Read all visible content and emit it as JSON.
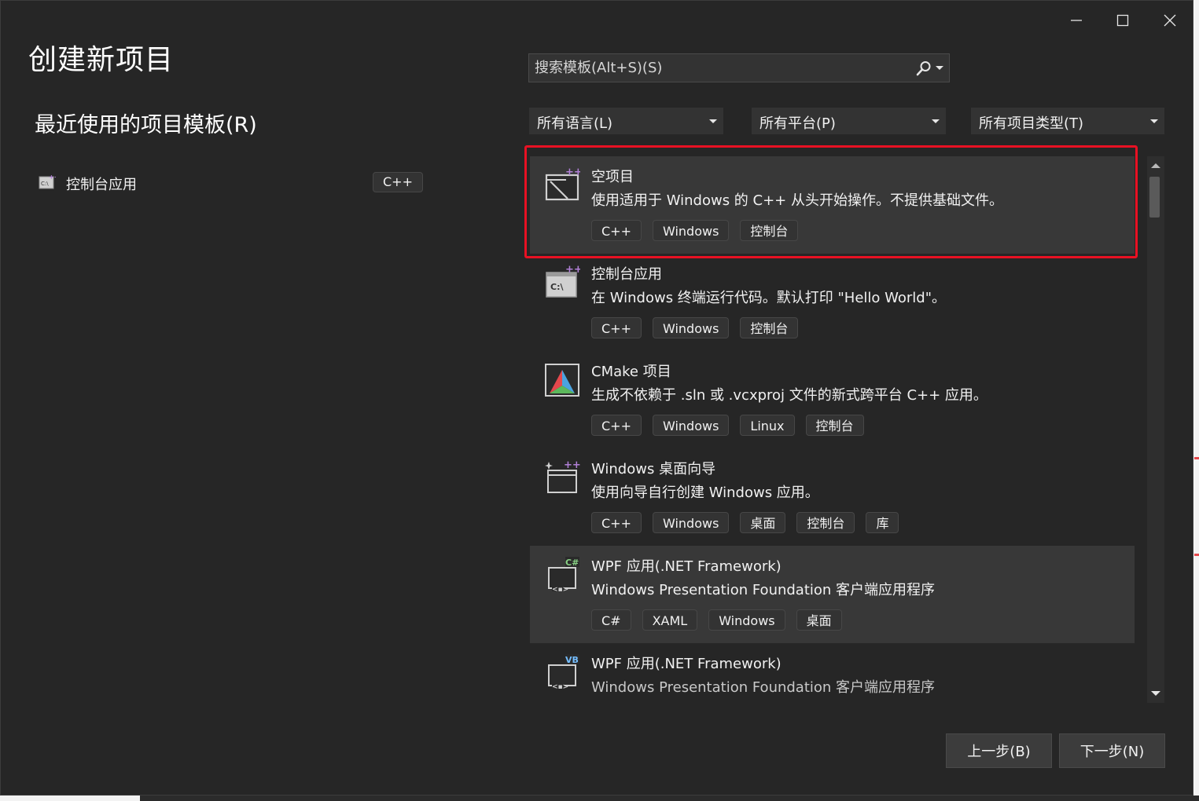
{
  "window": {
    "title": "创建新项目",
    "controls": [
      "minimize-icon",
      "maximize-icon",
      "close-icon"
    ]
  },
  "recent": {
    "heading": "最近使用的项目模板(R)",
    "items": [
      {
        "label": "控制台应用",
        "tag": "C++",
        "icon": "console-app-icon"
      }
    ]
  },
  "search": {
    "placeholder": "搜索模板(Alt+S)(S)",
    "value": ""
  },
  "filters": {
    "language": "所有语言(L)",
    "platform": "所有平台(P)",
    "project_type": "所有项目类型(T)"
  },
  "templates": [
    {
      "name": "空项目",
      "description": "使用适用于 Windows 的 C++ 从头开始操作。不提供基础文件。",
      "tags": [
        "C++",
        "Windows",
        "控制台"
      ],
      "icon": "empty-project-icon",
      "selected": true
    },
    {
      "name": "控制台应用",
      "description": "在 Windows 终端运行代码。默认打印 \"Hello World\"。",
      "tags": [
        "C++",
        "Windows",
        "控制台"
      ],
      "icon": "console-app-icon"
    },
    {
      "name": "CMake 项目",
      "description": "生成不依赖于 .sln 或 .vcxproj 文件的新式跨平台 C++ 应用。",
      "tags": [
        "C++",
        "Windows",
        "Linux",
        "控制台"
      ],
      "icon": "cmake-icon"
    },
    {
      "name": "Windows 桌面向导",
      "description": "使用向导自行创建 Windows 应用。",
      "tags": [
        "C++",
        "Windows",
        "桌面",
        "控制台",
        "库"
      ],
      "icon": "desktop-wizard-icon"
    },
    {
      "name": "WPF 应用(.NET Framework)",
      "description": "Windows Presentation Foundation 客户端应用程序",
      "tags": [
        "C#",
        "XAML",
        "Windows",
        "桌面"
      ],
      "icon": "wpf-csharp-icon",
      "hover": true
    },
    {
      "name": "WPF 应用(.NET Framework)",
      "description": "Windows Presentation Foundation 客户端应用程序",
      "tags": [],
      "icon": "wpf-vb-icon"
    }
  ],
  "buttons": {
    "back": "上一步(B)",
    "next": "下一步(N)"
  },
  "colors": {
    "background": "#262626",
    "highlight": "#e81123",
    "accent_purple": "#b180d7",
    "accent_green": "#89d185",
    "accent_blue": "#75beff"
  }
}
